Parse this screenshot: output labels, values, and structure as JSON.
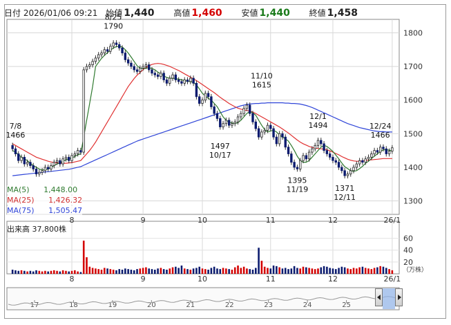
{
  "header": {
    "date_label": "日付",
    "date_value": "2026/01/06 09:21",
    "open_label": "始値",
    "open_value": "1,440",
    "high_label": "高値",
    "high_value": "1,460",
    "low_label": "安値",
    "low_value": "1,440",
    "close_label": "終値",
    "close_value": "1,458"
  },
  "legend": {
    "ma5_label": "MA(5)",
    "ma5_value": "1,448.00",
    "ma25_label": "MA(25)",
    "ma25_value": "1,426.32",
    "ma75_label": "MA(75)",
    "ma75_value": "1,505.47"
  },
  "volume_panel": {
    "label": "出来高",
    "value": "37,800株",
    "unit": "（万株）",
    "y_ticks": [
      "60",
      "40",
      "20"
    ]
  },
  "navigator": {
    "ticks": [
      "17",
      "18",
      "19",
      "20",
      "21",
      "22",
      "23",
      "24",
      "25"
    ]
  },
  "colors": {
    "up": "#d40000",
    "down": "#0a1a6e",
    "ma5": "#2f7a2f",
    "ma25": "#e03030",
    "ma75": "#2f45d8"
  },
  "chart_data": {
    "type": "candlestick",
    "y_ticks": [
      1300,
      1400,
      1500,
      1600,
      1700,
      1800
    ],
    "ylim": [
      1260,
      1840
    ],
    "x_ticks": [
      "8",
      "9",
      "10",
      "11",
      "12",
      "26/1"
    ],
    "grid": true,
    "annotations": [
      {
        "date": "7/8",
        "price": 1466
      },
      {
        "date": "8/25",
        "price": 1790
      },
      {
        "date": "10/17",
        "price": 1497
      },
      {
        "date": "11/10",
        "price": 1615
      },
      {
        "date": "11/19",
        "price": 1395
      },
      {
        "date": "12/1",
        "price": 1494
      },
      {
        "date": "12/11",
        "price": 1371
      },
      {
        "date": "12/24",
        "price": 1466
      }
    ],
    "closes": [
      1455,
      1440,
      1420,
      1430,
      1410,
      1415,
      1405,
      1395,
      1380,
      1385,
      1390,
      1400,
      1395,
      1405,
      1415,
      1420,
      1410,
      1425,
      1430,
      1420,
      1435,
      1440,
      1450,
      1445,
      1690,
      1700,
      1705,
      1715,
      1725,
      1735,
      1740,
      1750,
      1745,
      1760,
      1770,
      1765,
      1755,
      1740,
      1720,
      1710,
      1700,
      1690,
      1685,
      1695,
      1700,
      1705,
      1690,
      1680,
      1675,
      1670,
      1680,
      1660,
      1650,
      1665,
      1675,
      1660,
      1655,
      1650,
      1660,
      1655,
      1665,
      1650,
      1610,
      1590,
      1600,
      1620,
      1610,
      1580,
      1560,
      1545,
      1520,
      1530,
      1540,
      1525,
      1530,
      1535,
      1550,
      1560,
      1575,
      1585,
      1560,
      1535,
      1515,
      1490,
      1505,
      1510,
      1525,
      1515,
      1490,
      1470,
      1500,
      1490,
      1460,
      1440,
      1415,
      1400,
      1395,
      1420,
      1435,
      1425,
      1445,
      1455,
      1465,
      1480,
      1470,
      1450,
      1440,
      1430,
      1420,
      1415,
      1400,
      1390,
      1375,
      1380,
      1390,
      1400,
      1410,
      1420,
      1415,
      1425,
      1430,
      1440,
      1450,
      1445,
      1460,
      1455,
      1440,
      1448,
      1458
    ],
    "volumes": [
      7,
      6,
      5,
      6,
      5,
      4,
      5,
      4,
      6,
      5,
      4,
      5,
      4,
      5,
      6,
      5,
      4,
      6,
      5,
      4,
      5,
      6,
      4,
      3,
      56,
      28,
      12,
      10,
      9,
      8,
      7,
      10,
      9,
      8,
      7,
      6,
      8,
      7,
      9,
      8,
      7,
      6,
      8,
      9,
      10,
      11,
      9,
      8,
      7,
      9,
      10,
      8,
      7,
      9,
      11,
      12,
      10,
      14,
      9,
      8,
      7,
      9,
      10,
      12,
      9,
      8,
      7,
      10,
      12,
      9,
      8,
      10,
      9,
      8,
      7,
      11,
      14,
      10,
      12,
      9,
      8,
      7,
      10,
      44,
      22,
      12,
      10,
      9,
      14,
      13,
      11,
      9,
      10,
      8,
      9,
      13,
      10,
      9,
      12,
      11,
      10,
      9,
      8,
      9,
      11,
      13,
      12,
      10,
      9,
      8,
      10,
      12,
      11,
      9,
      8,
      10,
      9,
      11,
      12,
      10,
      9,
      8,
      10,
      11,
      13,
      12,
      10,
      8,
      6
    ],
    "ma5": [
      1450,
      1445,
      1438,
      1430,
      1425,
      1420,
      1412,
      1405,
      1400,
      1395,
      1392,
      1393,
      1395,
      1400,
      1405,
      1410,
      1413,
      1418,
      1422,
      1425,
      1428,
      1432,
      1437,
      1440,
      1490,
      1540,
      1590,
      1640,
      1700,
      1712,
      1724,
      1733,
      1741,
      1748,
      1755,
      1759,
      1760,
      1758,
      1750,
      1740,
      1728,
      1715,
      1702,
      1695,
      1694,
      1695,
      1696,
      1694,
      1690,
      1683,
      1678,
      1672,
      1667,
      1665,
      1665,
      1664,
      1662,
      1660,
      1658,
      1656,
      1655,
      1652,
      1645,
      1633,
      1620,
      1612,
      1605,
      1600,
      1590,
      1580,
      1565,
      1550,
      1540,
      1535,
      1532,
      1530,
      1533,
      1540,
      1550,
      1560,
      1566,
      1562,
      1555,
      1540,
      1525,
      1512,
      1505,
      1508,
      1510,
      1505,
      1496,
      1490,
      1485,
      1478,
      1465,
      1450,
      1433,
      1420,
      1415,
      1415,
      1420,
      1430,
      1440,
      1450,
      1460,
      1465,
      1462,
      1455,
      1447,
      1436,
      1425,
      1413,
      1402,
      1396,
      1390,
      1388,
      1390,
      1396,
      1403,
      1412,
      1418,
      1426,
      1433,
      1440,
      1447,
      1452,
      1452,
      1451,
      1448
    ],
    "ma25": [
      1470,
      1465,
      1460,
      1455,
      1450,
      1445,
      1440,
      1435,
      1430,
      1427,
      1424,
      1421,
      1418,
      1416,
      1414,
      1413,
      1412,
      1412,
      1412,
      1413,
      1414,
      1416,
      1418,
      1420,
      1430,
      1440,
      1450,
      1462,
      1475,
      1490,
      1505,
      1520,
      1535,
      1550,
      1565,
      1580,
      1595,
      1610,
      1625,
      1640,
      1652,
      1664,
      1674,
      1682,
      1690,
      1697,
      1702,
      1706,
      1708,
      1709,
      1708,
      1706,
      1703,
      1700,
      1696,
      1692,
      1688,
      1683,
      1678,
      1673,
      1668,
      1663,
      1658,
      1652,
      1646,
      1640,
      1634,
      1628,
      1622,
      1615,
      1608,
      1602,
      1596,
      1590,
      1585,
      1580,
      1576,
      1573,
      1571,
      1569,
      1567,
      1564,
      1560,
      1555,
      1550,
      1545,
      1540,
      1535,
      1530,
      1525,
      1520,
      1514,
      1508,
      1502,
      1495,
      1488,
      1481,
      1475,
      1470,
      1466,
      1462,
      1459,
      1457,
      1456,
      1455,
      1454,
      1452,
      1449,
      1445,
      1441,
      1437,
      1432,
      1428,
      1424,
      1421,
      1419,
      1418,
      1418,
      1419,
      1420,
      1421,
      1422,
      1423,
      1424,
      1425,
      1426,
      1426,
      1426,
      1426
    ],
    "ma75": [
      1375,
      1376,
      1377,
      1378,
      1379,
      1380,
      1381,
      1382,
      1383,
      1384,
      1385,
      1386,
      1387,
      1388,
      1389,
      1390,
      1391,
      1392,
      1393,
      1394,
      1396,
      1398,
      1400,
      1402,
      1406,
      1410,
      1414,
      1418,
      1422,
      1426,
      1430,
      1434,
      1438,
      1442,
      1446,
      1450,
      1454,
      1458,
      1462,
      1466,
      1470,
      1474,
      1478,
      1481,
      1484,
      1487,
      1490,
      1493,
      1496,
      1499,
      1502,
      1505,
      1508,
      1511,
      1514,
      1517,
      1520,
      1523,
      1526,
      1529,
      1532,
      1535,
      1538,
      1541,
      1544,
      1547,
      1550,
      1553,
      1556,
      1559,
      1562,
      1565,
      1568,
      1571,
      1574,
      1577,
      1580,
      1583,
      1585,
      1587,
      1588,
      1589,
      1590,
      1590,
      1591,
      1591,
      1592,
      1592,
      1592,
      1592,
      1592,
      1592,
      1591,
      1591,
      1590,
      1590,
      1589,
      1588,
      1586,
      1584,
      1581,
      1578,
      1574,
      1570,
      1566,
      1562,
      1558,
      1554,
      1550,
      1546,
      1542,
      1538,
      1534,
      1530,
      1527,
      1524,
      1521,
      1518,
      1516,
      1514,
      1512,
      1510,
      1508,
      1507,
      1506,
      1506,
      1505,
      1505,
      1505
    ]
  }
}
